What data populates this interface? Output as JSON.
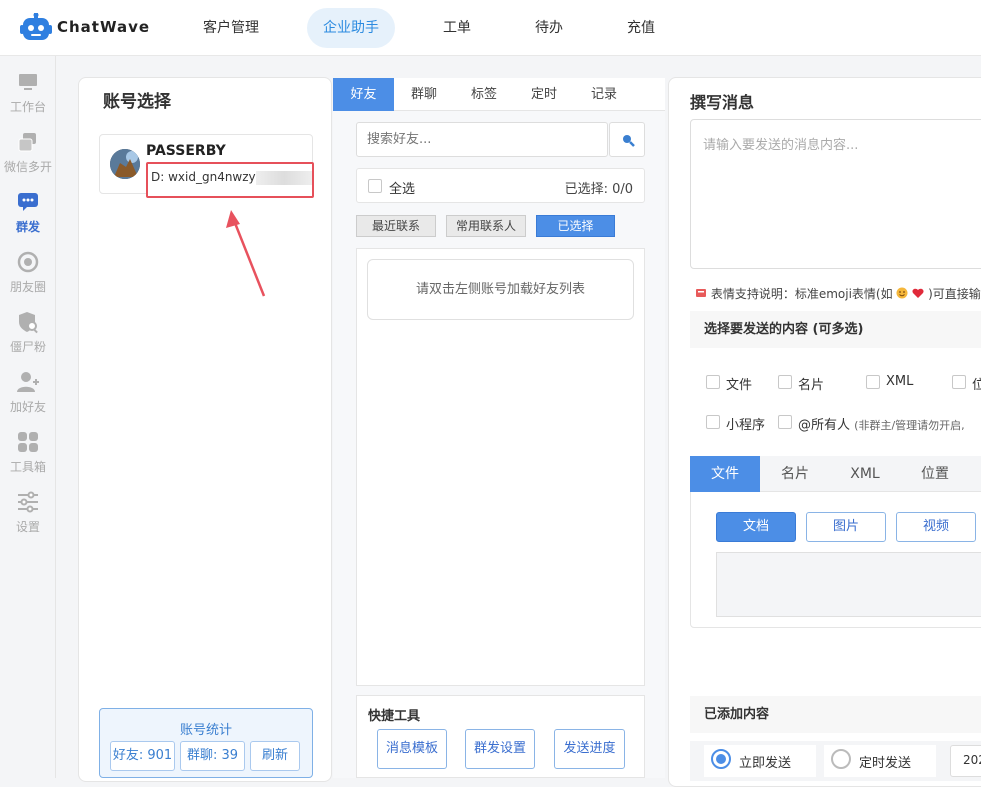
{
  "brand": {
    "name": "ChatWave"
  },
  "topnav": [
    {
      "label": "客户管理"
    },
    {
      "label": "企业助手",
      "active": true
    },
    {
      "label": "工单"
    },
    {
      "label": "待办"
    },
    {
      "label": "充值"
    }
  ],
  "sidebar": {
    "items": [
      {
        "label": "工作台",
        "icon": "monitor-icon"
      },
      {
        "label": "微信多开",
        "icon": "windows-icon"
      },
      {
        "label": "群发",
        "icon": "broadcast-icon",
        "active": true
      },
      {
        "label": "朋友圈",
        "icon": "moments-icon"
      },
      {
        "label": "僵尸粉",
        "icon": "shield-search-icon"
      },
      {
        "label": "加好友",
        "icon": "add-user-icon"
      },
      {
        "label": "工具箱",
        "icon": "toolbox-icon"
      },
      {
        "label": "设置",
        "icon": "sliders-icon"
      }
    ]
  },
  "account": {
    "title": "账号选择",
    "name": "PASSERBY",
    "id": "D: wxid_gn4nwzy",
    "stats": {
      "title": "账号统计",
      "friends": "好友: 901",
      "groups": "群聊: 39",
      "refresh": "刷新"
    }
  },
  "friends": {
    "tabs": [
      "好友",
      "群聊",
      "标签",
      "定时",
      "记录"
    ],
    "search_placeholder": "搜索好友...",
    "select_all": "全选",
    "selected": "已选择: 0/0",
    "filters": [
      "最近联系",
      "常用联系人",
      "已选择"
    ],
    "empty_message": "请双击左侧账号加载好友列表",
    "quick_tools": {
      "title": "快捷工具",
      "buttons": [
        "消息模板",
        "群发设置",
        "发送进度"
      ]
    }
  },
  "compose": {
    "title": "撰写消息",
    "placeholder": "请输入要发送的消息内容...",
    "emoji_note": "表情支持说明：标准emoji表情(如",
    "emoji_note_tail": ")可直接输入",
    "content_title": "选择要发送的内容 (可多选)",
    "options_row1": [
      "文件",
      "名片",
      "XML",
      "位"
    ],
    "options_row2_a": "小程序",
    "options_row2_b": "@所有人",
    "options_row2_hint": "(非群主/管理请勿开启,",
    "content_tabs": [
      "文件",
      "名片",
      "XML",
      "位置"
    ],
    "file_types": [
      "文档",
      "图片",
      "视频"
    ],
    "added_title": "已添加内容",
    "send_now": "立即发送",
    "send_timed": "定时发送",
    "date_partial": "202"
  },
  "colors": {
    "accent": "#4c8ee6",
    "highlight_box": "#e6505a",
    "annotation_arrow": "#e8525e"
  }
}
